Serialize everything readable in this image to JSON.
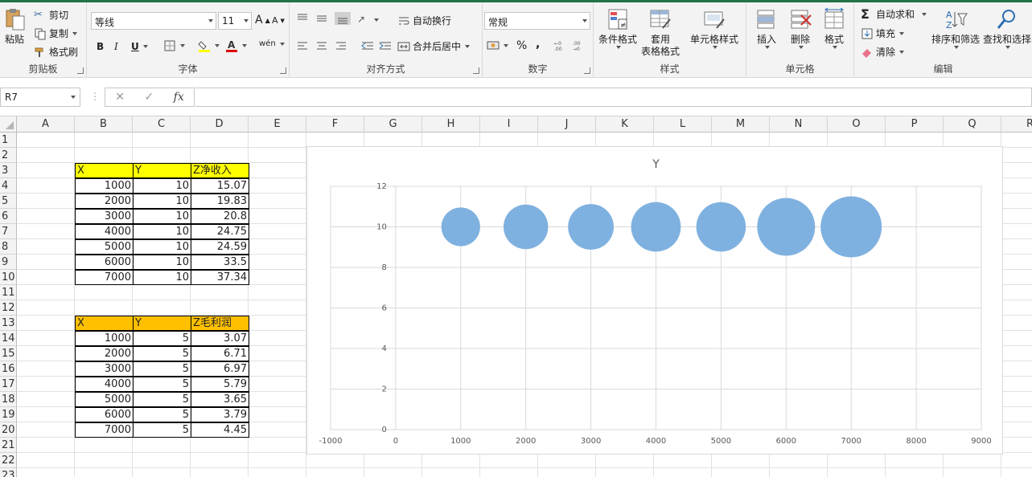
{
  "ribbon": {
    "clipboard": {
      "paste": "粘贴",
      "cut": "剪切",
      "copy": "复制",
      "format_painter": "格式刷",
      "label": "剪贴板"
    },
    "font": {
      "name": "等线",
      "size": "11",
      "label": "字体",
      "bold": "B",
      "italic": "I",
      "underline": "U",
      "grow": "A",
      "shrink": "A",
      "phonetic": "wén"
    },
    "alignment": {
      "wrap": "自动换行",
      "merge": "合并后居中",
      "label": "对齐方式"
    },
    "number": {
      "format": "常规",
      "percent": "%",
      "comma": ",",
      "label": "数字"
    },
    "styles": {
      "conditional": "条件格式",
      "table_line1": "套用",
      "table_line2": "表格格式",
      "cell_styles": "单元格样式",
      "label": "样式"
    },
    "cells": {
      "insert": "插入",
      "delete": "删除",
      "format": "格式",
      "label": "单元格"
    },
    "editing": {
      "autosum": "自动求和",
      "fill": "填充",
      "clear": "清除",
      "sort": "排序和筛选",
      "find": "查找和选择",
      "label": "编辑"
    }
  },
  "formula_bar": {
    "name_box": "R7",
    "fx": "fx",
    "cancel": "✕",
    "enter": "✓",
    "value": ""
  },
  "columns": [
    "A",
    "B",
    "C",
    "D",
    "E",
    "F",
    "G",
    "H",
    "I",
    "J",
    "K",
    "L",
    "M",
    "N",
    "O",
    "P",
    "Q",
    "R"
  ],
  "rows": [
    "1",
    "2",
    "3",
    "4",
    "5",
    "6",
    "7",
    "8",
    "9",
    "10",
    "11",
    "12",
    "13",
    "14",
    "15",
    "16",
    "17",
    "18",
    "19",
    "20",
    "21",
    "22",
    "23"
  ],
  "table1": {
    "headers": [
      "X",
      "Y",
      "Z净收入"
    ],
    "rows": [
      [
        "1000",
        "10",
        "15.07"
      ],
      [
        "2000",
        "10",
        "19.83"
      ],
      [
        "3000",
        "10",
        "20.8"
      ],
      [
        "4000",
        "10",
        "24.75"
      ],
      [
        "5000",
        "10",
        "24.59"
      ],
      [
        "6000",
        "10",
        "33.5"
      ],
      [
        "7000",
        "10",
        "37.34"
      ]
    ],
    "header_color": "#ffff00"
  },
  "table2": {
    "headers": [
      "X",
      "Y",
      "Z毛利润"
    ],
    "rows": [
      [
        "1000",
        "5",
        "3.07"
      ],
      [
        "2000",
        "5",
        "6.71"
      ],
      [
        "3000",
        "5",
        "6.97"
      ],
      [
        "4000",
        "5",
        "5.79"
      ],
      [
        "5000",
        "5",
        "3.65"
      ],
      [
        "6000",
        "5",
        "3.79"
      ],
      [
        "7000",
        "5",
        "4.45"
      ]
    ],
    "header_color": "#ffc000"
  },
  "chart_data": {
    "type": "scatter",
    "title": "Y",
    "xlabel": "",
    "ylabel": "",
    "xlim": [
      -1000,
      9000
    ],
    "ylim": [
      0,
      12
    ],
    "x_ticks": [
      "-1000",
      "0",
      "1000",
      "2000",
      "3000",
      "4000",
      "5000",
      "6000",
      "7000",
      "8000",
      "9000"
    ],
    "y_ticks": [
      "0",
      "2",
      "4",
      "6",
      "8",
      "10",
      "12"
    ],
    "grid": true,
    "legend": "none",
    "series": [
      {
        "x": [
          1000,
          2000,
          3000,
          4000,
          5000,
          6000,
          7000
        ],
        "y": [
          10,
          10,
          10,
          10,
          10,
          10,
          10
        ],
        "size": [
          15.07,
          19.83,
          20.8,
          24.75,
          24.59,
          33.5,
          37.34
        ],
        "color": "#7fb1e0"
      }
    ]
  }
}
